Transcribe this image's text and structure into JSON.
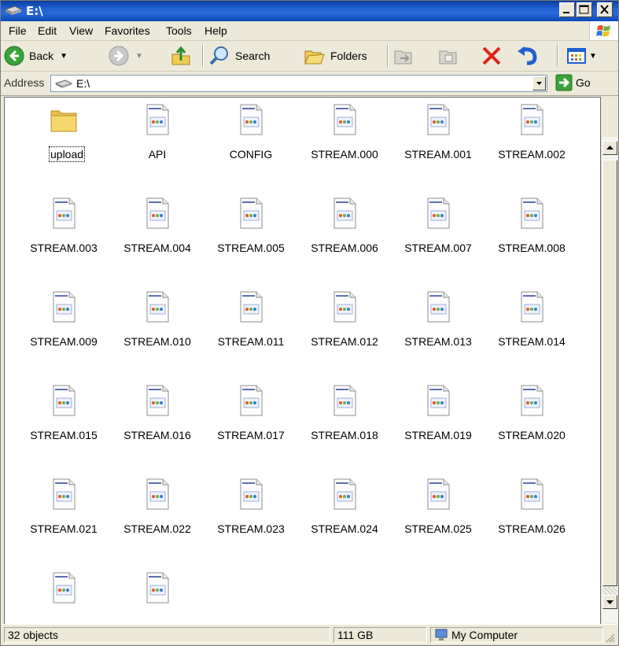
{
  "window": {
    "title": "E:\\"
  },
  "menu": [
    "File",
    "Edit",
    "View",
    "Favorites",
    "Tools",
    "Help"
  ],
  "toolbar": {
    "back_label": "Back",
    "search_label": "Search",
    "folders_label": "Folders"
  },
  "address": {
    "label": "Address",
    "value": "E:\\",
    "go_label": "Go"
  },
  "items": [
    {
      "name": "upload",
      "type": "folder"
    },
    {
      "name": "API",
      "type": "file"
    },
    {
      "name": "CONFIG",
      "type": "file"
    },
    {
      "name": "STREAM.000",
      "type": "file"
    },
    {
      "name": "STREAM.001",
      "type": "file"
    },
    {
      "name": "STREAM.002",
      "type": "file"
    },
    {
      "name": "STREAM.003",
      "type": "file"
    },
    {
      "name": "STREAM.004",
      "type": "file"
    },
    {
      "name": "STREAM.005",
      "type": "file"
    },
    {
      "name": "STREAM.006",
      "type": "file"
    },
    {
      "name": "STREAM.007",
      "type": "file"
    },
    {
      "name": "STREAM.008",
      "type": "file"
    },
    {
      "name": "STREAM.009",
      "type": "file"
    },
    {
      "name": "STREAM.010",
      "type": "file"
    },
    {
      "name": "STREAM.011",
      "type": "file"
    },
    {
      "name": "STREAM.012",
      "type": "file"
    },
    {
      "name": "STREAM.013",
      "type": "file"
    },
    {
      "name": "STREAM.014",
      "type": "file"
    },
    {
      "name": "STREAM.015",
      "type": "file"
    },
    {
      "name": "STREAM.016",
      "type": "file"
    },
    {
      "name": "STREAM.017",
      "type": "file"
    },
    {
      "name": "STREAM.018",
      "type": "file"
    },
    {
      "name": "STREAM.019",
      "type": "file"
    },
    {
      "name": "STREAM.020",
      "type": "file"
    },
    {
      "name": "STREAM.021",
      "type": "file"
    },
    {
      "name": "STREAM.022",
      "type": "file"
    },
    {
      "name": "STREAM.023",
      "type": "file"
    },
    {
      "name": "STREAM.024",
      "type": "file"
    },
    {
      "name": "STREAM.025",
      "type": "file"
    },
    {
      "name": "STREAM.026",
      "type": "file"
    },
    {
      "name": "",
      "type": "file"
    },
    {
      "name": "",
      "type": "file"
    }
  ],
  "status": {
    "objects": "32 objects",
    "size": "111 GB",
    "location": "My Computer"
  },
  "colors": {
    "title_bar": "#0a3e9c",
    "window_face": "#ece9d8",
    "folder": "#f0cc55",
    "close_red": "#e2231a"
  }
}
